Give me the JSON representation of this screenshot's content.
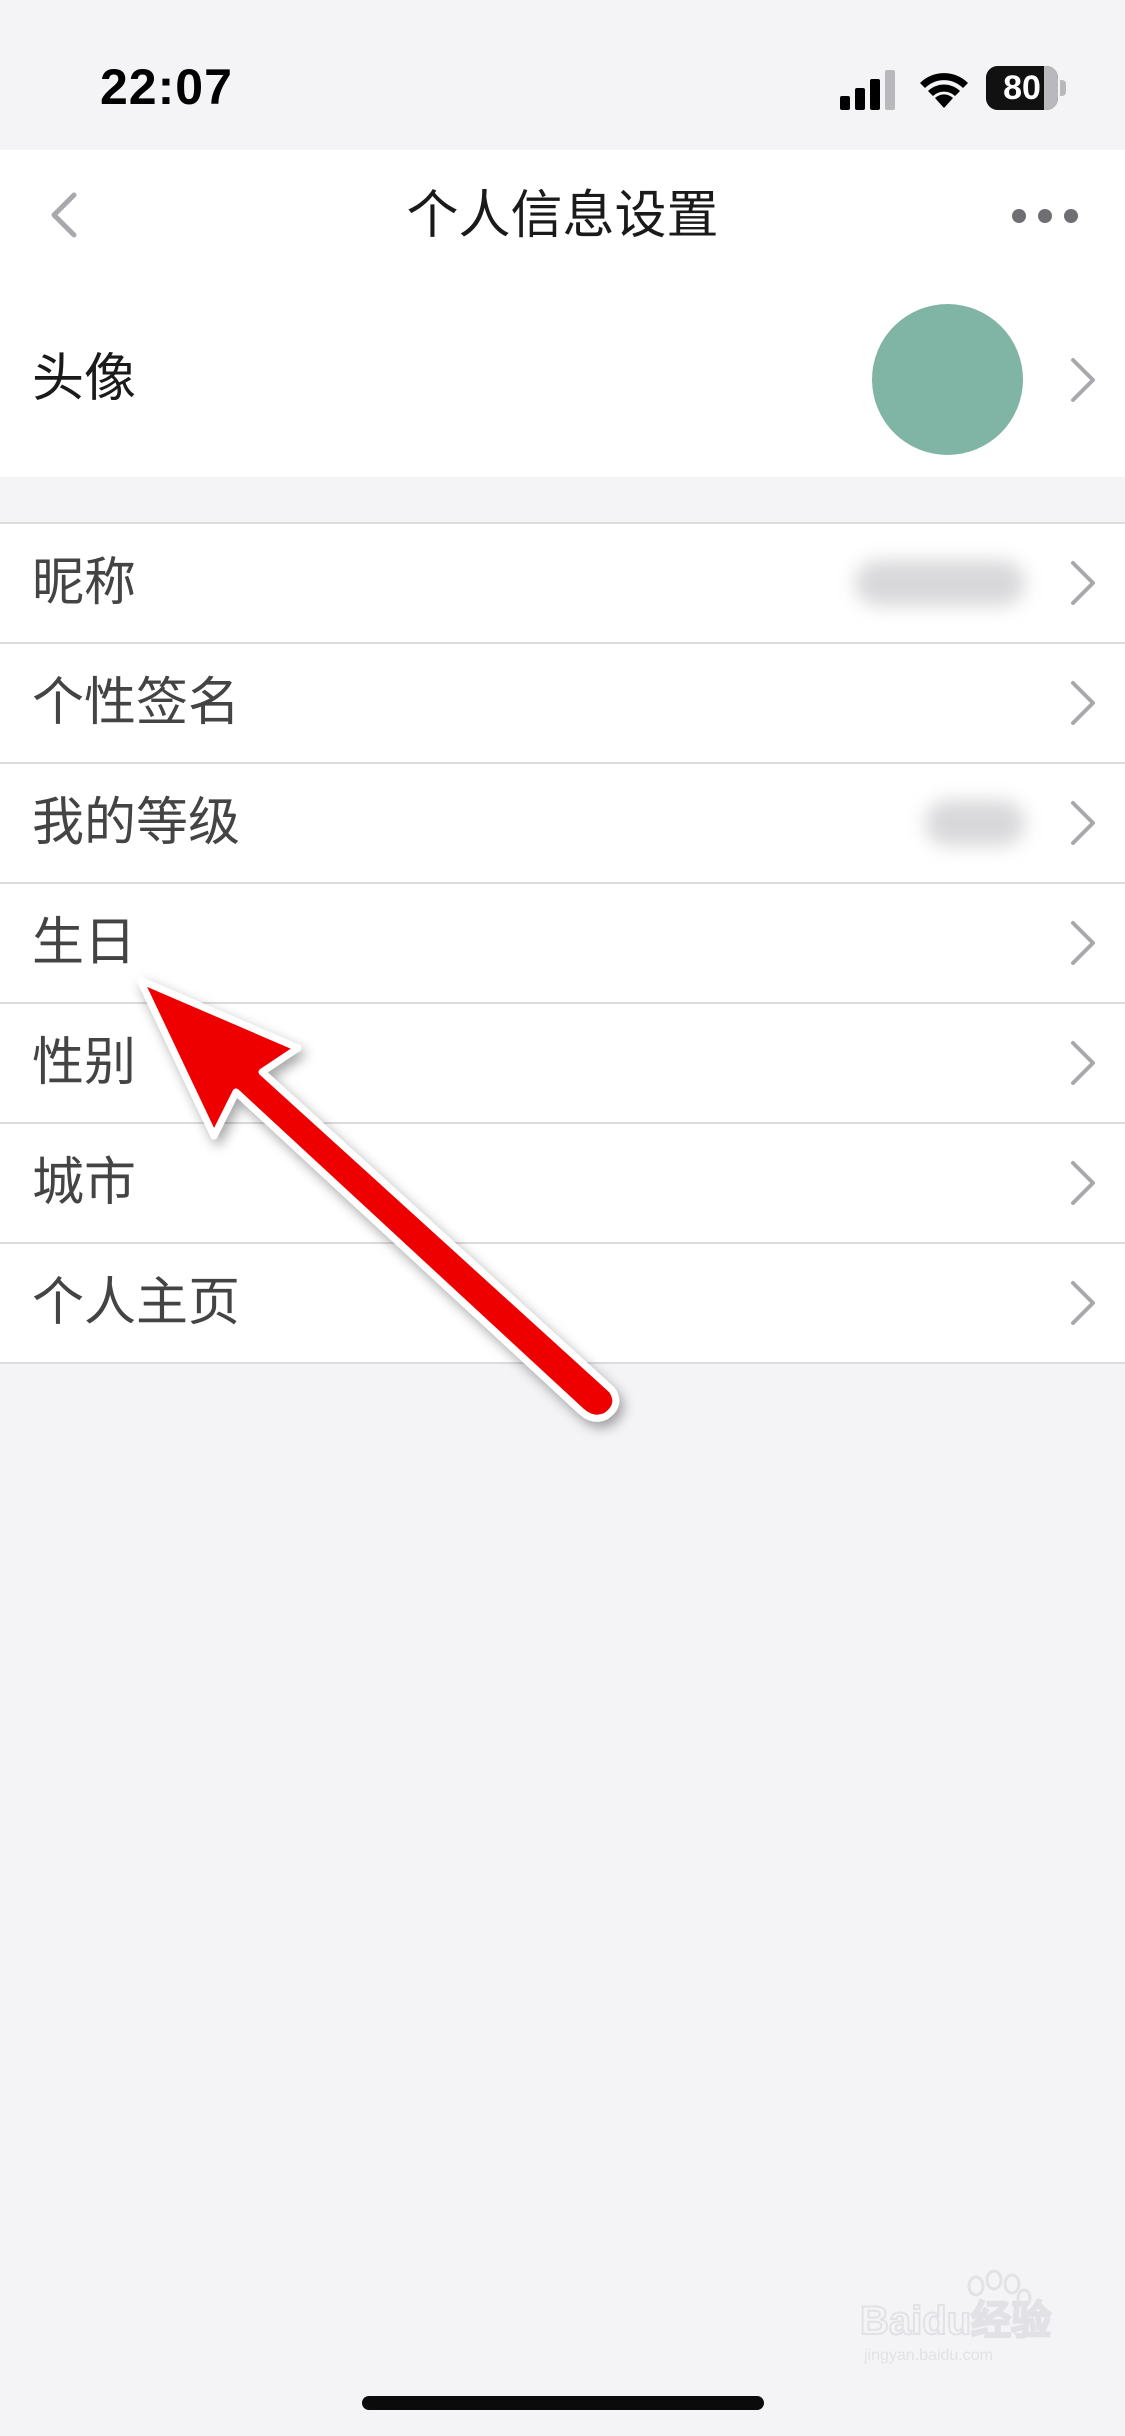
{
  "status_bar": {
    "time": "22:07",
    "battery_percent": "80",
    "battery_level": 0.8,
    "signal_bars_active": 3,
    "signal_bars_total": 4
  },
  "nav": {
    "title": "个人信息设置",
    "back_icon": "chevron-left-icon",
    "more_icon": "more-horizontal-icon"
  },
  "avatar_row": {
    "label": "头像",
    "avatar_color": "#80b4a4"
  },
  "list": [
    {
      "key": "nickname",
      "label": "昵称",
      "value_blurred": true
    },
    {
      "key": "signature",
      "label": "个性签名",
      "value_blurred": false
    },
    {
      "key": "level",
      "label": "我的等级",
      "value_blurred": true
    },
    {
      "key": "birthday",
      "label": "生日",
      "value_blurred": false
    },
    {
      "key": "gender",
      "label": "性别",
      "value_blurred": false
    },
    {
      "key": "city",
      "label": "城市",
      "value_blurred": false
    },
    {
      "key": "homepage",
      "label": "个人主页",
      "value_blurred": false
    }
  ],
  "annotation": {
    "arrow_color": "#ff0000",
    "target": "生日"
  },
  "watermark": {
    "text": "Baidu经验",
    "subtext": "jingyan.baidu.com"
  },
  "colors": {
    "background": "#f4f4f7",
    "surface": "#ffffff",
    "divider": "#dcdcdf",
    "chevron": "#a9a9ad"
  }
}
